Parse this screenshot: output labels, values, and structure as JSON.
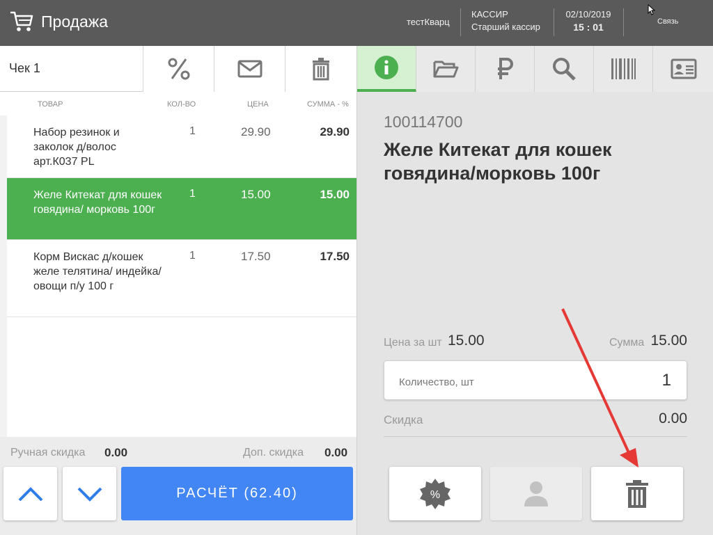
{
  "header": {
    "title": "Продажа",
    "store": "тестКварц",
    "cashier_role": "КАССИР",
    "cashier_name": "Старший кассир",
    "date": "02/10/2019",
    "time": "15 : 01",
    "link": "Связь"
  },
  "check": {
    "title": "Чек 1",
    "columns": {
      "product": "ТОВАР",
      "qty": "КОЛ-ВО",
      "price": "ЦЕНА",
      "sum": "СУММА - %"
    },
    "items": [
      {
        "name": "Набор резинок и заколок д/волос арт.К037 PL",
        "qty": "1",
        "price": "29.90",
        "sum": "29.90"
      },
      {
        "name": "Желе Китекат для кошек говядина/ морковь 100г",
        "qty": "1",
        "price": "15.00",
        "sum": "15.00",
        "selected": true
      },
      {
        "name": "Корм Вискас д/кошек желе телятина/ индейка/овощи п/у 100 г",
        "qty": "1",
        "price": "17.50",
        "sum": "17.50"
      }
    ],
    "manual_discount_label": "Ручная скидка",
    "manual_discount_value": "0.00",
    "extra_discount_label": "Доп. скидка",
    "extra_discount_value": "0.00",
    "pay_label": "РАСЧЁТ (62.40)"
  },
  "product": {
    "code": "100114700",
    "name": "Желе Китекат для кошек говядина/морковь 100г",
    "price_label": "Цена за шт",
    "price_value": "15.00",
    "sum_label": "Сумма",
    "sum_value": "15.00",
    "qty_label": "Количество, шт",
    "qty_value": "1",
    "discount_label": "Скидка",
    "discount_value": "0.00"
  },
  "colors": {
    "accent_green": "#4caf50",
    "pay_blue": "#4285f4",
    "header_bg": "#5a5a5a",
    "annotation_red": "#e53935"
  }
}
